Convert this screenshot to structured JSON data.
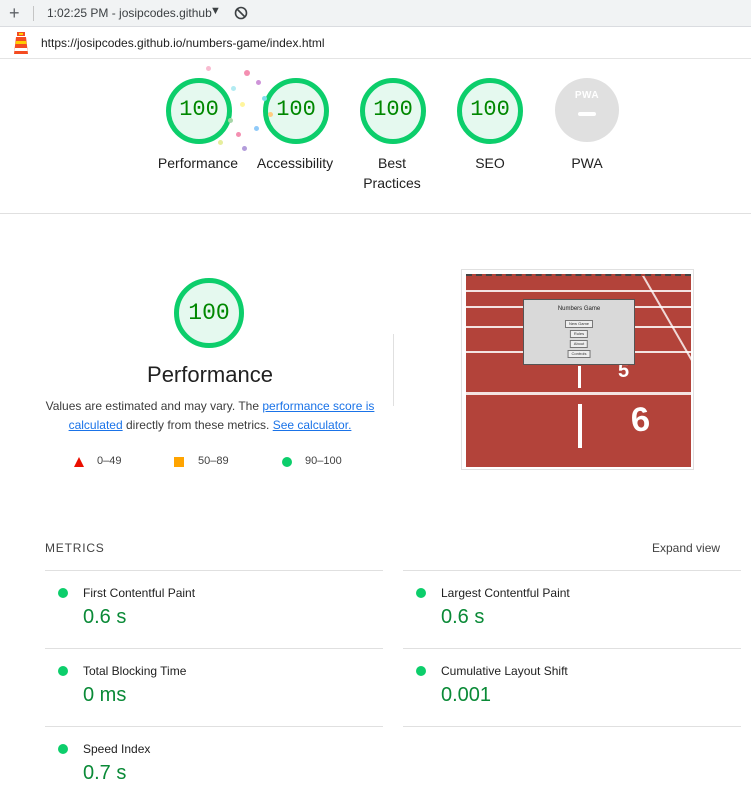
{
  "toolbar": {
    "new_icon": "+",
    "session": "1:02:25 PM - josipcodes.github",
    "dropdown_icon": "▼"
  },
  "urlbar": {
    "url": "https://josipcodes.github.io/numbers-game/index.html"
  },
  "gauges": [
    {
      "score": "100",
      "label": "Performance"
    },
    {
      "score": "100",
      "label": "Accessibility"
    },
    {
      "score": "100",
      "label": "Best Practices"
    },
    {
      "score": "100",
      "label": "SEO"
    },
    {
      "score": "PWA",
      "label": "PWA"
    }
  ],
  "performance": {
    "score": "100",
    "title": "Performance",
    "desc_pre": "Values are estimated and may vary. The ",
    "desc_link1": "performance score is calculated",
    "desc_mid": " directly from these metrics. ",
    "desc_link2": "See calculator."
  },
  "legend": [
    {
      "range": "0–49",
      "color": "#eb0f00"
    },
    {
      "range": "50–89",
      "color": "#ffa400"
    },
    {
      "range": "90–100",
      "color": "#0cce6b"
    }
  ],
  "thumbnail": {
    "title": "Numbers Game",
    "buttons": [
      "New Game",
      "Rules",
      "About",
      "Controls"
    ],
    "lane_5": "5",
    "lane_6": "6"
  },
  "metrics": {
    "header": "METRICS",
    "expand": "Expand view",
    "items": [
      {
        "label": "First Contentful Paint",
        "value": "0.6 s"
      },
      {
        "label": "Largest Contentful Paint",
        "value": "0.6 s"
      },
      {
        "label": "Total Blocking Time",
        "value": "0 ms"
      },
      {
        "label": "Cumulative Layout Shift",
        "value": "0.001"
      },
      {
        "label": "Speed Index",
        "value": "0.7 s"
      }
    ]
  },
  "colors": {
    "pass": "#0cce6b",
    "pass_text": "#008800",
    "link": "#1a73e8"
  }
}
